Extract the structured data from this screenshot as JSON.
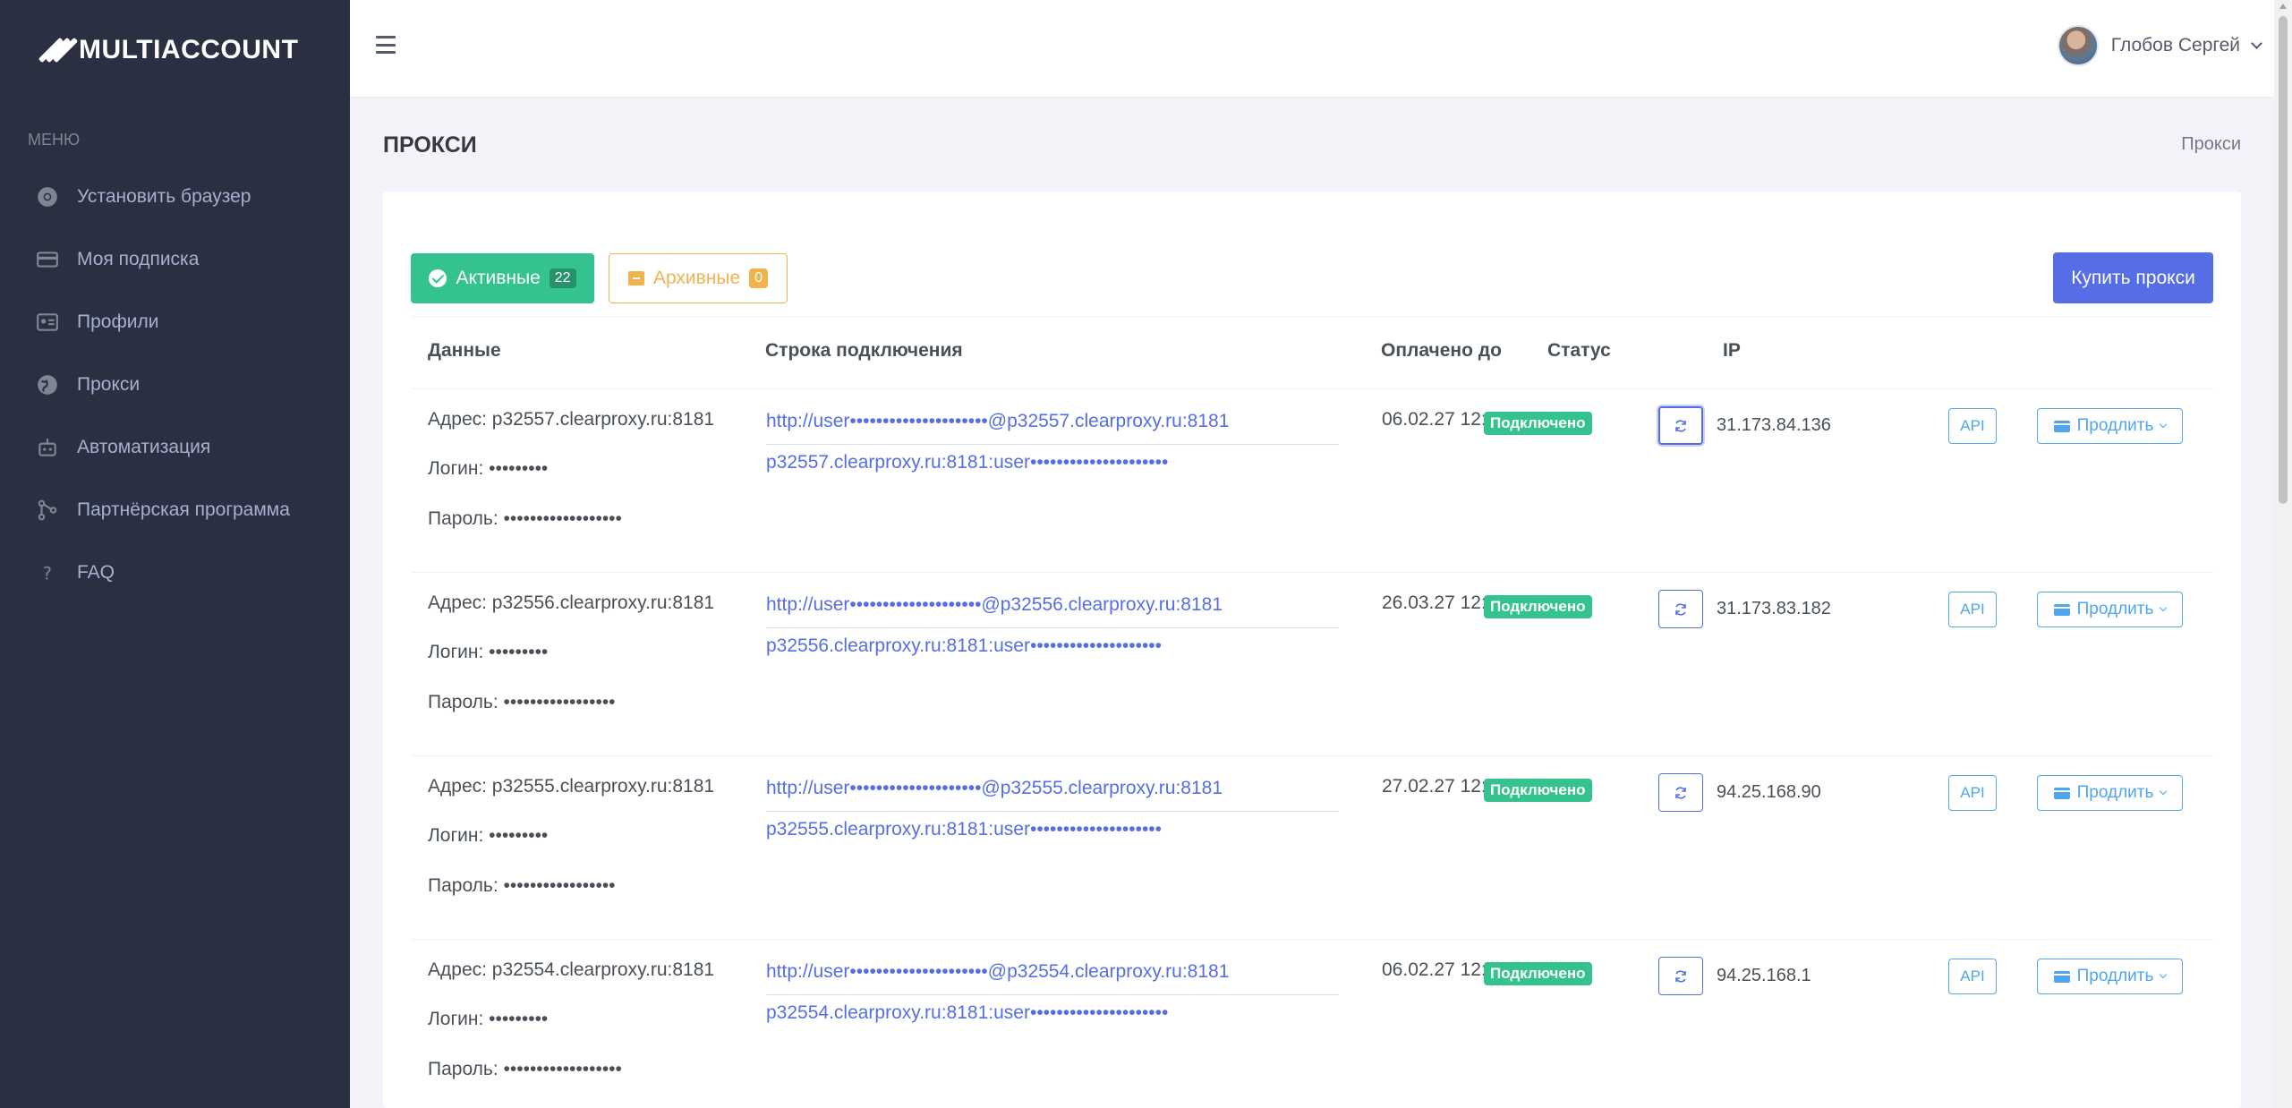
{
  "app": {
    "logo_text": "MULTIACCOUNT"
  },
  "sidebar": {
    "menu_title": "Меню",
    "items": [
      {
        "label": "Установить браузер",
        "icon": "chrome-icon"
      },
      {
        "label": "Моя подписка",
        "icon": "credit-card-icon"
      },
      {
        "label": "Профили",
        "icon": "id-card-icon"
      },
      {
        "label": "Прокси",
        "icon": "globe-icon"
      },
      {
        "label": "Автоматизация",
        "icon": "robot-icon"
      },
      {
        "label": "Партнёрская программа",
        "icon": "share-icon"
      },
      {
        "label": "FAQ",
        "icon": "question-icon"
      }
    ]
  },
  "header": {
    "user_name": "Глобов Сергей"
  },
  "page": {
    "title": "ПРОКСИ",
    "breadcrumb": "Прокси"
  },
  "toolbar": {
    "active_label": "Активные",
    "active_count": "22",
    "archive_label": "Архивные",
    "archive_count": "0",
    "buy_label": "Купить прокси"
  },
  "table": {
    "headers": {
      "data": "Данные",
      "conn": "Строка подключения",
      "paid": "Оплачено до",
      "status": "Статус",
      "ip": "IP"
    },
    "rows": [
      {
        "address": "Адрес: p32557.clearproxy.ru:8181",
        "login": "Логин: •••••••••",
        "password": "Пароль: ••••••••••••••••••",
        "conn1": "http://user•••••••••••••••••••••@p32557.clearproxy.ru:8181",
        "conn2": "p32557.clearproxy.ru:8181:user•••••••••••••••••••••",
        "paid": "06.02.27 12:00",
        "status": "Подключено",
        "ip": "31.173.84.136",
        "api": "API",
        "extend": "Продлить"
      },
      {
        "address": "Адрес: p32556.clearproxy.ru:8181",
        "login": "Логин: •••••••••",
        "password": "Пароль: •••••••••••••••••",
        "conn1": "http://user••••••••••••••••••••@p32556.clearproxy.ru:8181",
        "conn2": "p32556.clearproxy.ru:8181:user••••••••••••••••••••",
        "paid": "26.03.27 12:00",
        "status": "Подключено",
        "ip": "31.173.83.182",
        "api": "API",
        "extend": "Продлить"
      },
      {
        "address": "Адрес: p32555.clearproxy.ru:8181",
        "login": "Логин: •••••••••",
        "password": "Пароль: •••••••••••••••••",
        "conn1": "http://user••••••••••••••••••••@p32555.clearproxy.ru:8181",
        "conn2": "p32555.clearproxy.ru:8181:user••••••••••••••••••••",
        "paid": "27.02.27 12:00",
        "status": "Подключено",
        "ip": "94.25.168.90",
        "api": "API",
        "extend": "Продлить"
      },
      {
        "address": "Адрес: p32554.clearproxy.ru:8181",
        "login": "Логин: •••••••••",
        "password": "Пароль: ••••••••••••••••••",
        "conn1": "http://user•••••••••••••••••••••@p32554.clearproxy.ru:8181",
        "conn2": "p32554.clearproxy.ru:8181:user•••••••••••••••••••••",
        "paid": "06.02.27 12:00",
        "status": "Подключено",
        "ip": "94.25.168.1",
        "api": "API",
        "extend": "Продлить"
      }
    ]
  }
}
